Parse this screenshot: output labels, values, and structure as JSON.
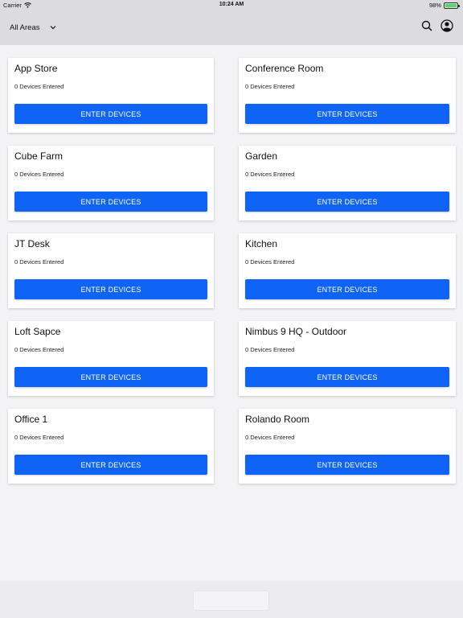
{
  "status_bar": {
    "carrier": "Carrier",
    "time": "10:24 AM",
    "battery": "98%",
    "battery_level": 0.98,
    "battery_color": "#4cd964"
  },
  "nav": {
    "area_filter": "All Areas",
    "icons": [
      "chevron-down-icon",
      "search-icon",
      "profile-icon"
    ]
  },
  "theme": {
    "accent": "#0f63f5",
    "background": "#f3f3f6"
  },
  "areas": [
    {
      "name": "App Store",
      "devices": "0 Devices Entered",
      "button": "ENTER DEVICES"
    },
    {
      "name": "Conference Room",
      "devices": "0 Devices Entered",
      "button": "ENTER DEVICES"
    },
    {
      "name": "Cube Farm",
      "devices": "0 Devices Entered",
      "button": "ENTER DEVICES"
    },
    {
      "name": "Garden",
      "devices": "0 Devices Entered",
      "button": "ENTER DEVICES"
    },
    {
      "name": "JT Desk",
      "devices": "0 Devices Entered",
      "button": "ENTER DEVICES"
    },
    {
      "name": "Kitchen",
      "devices": "0 Devices Entered",
      "button": "ENTER DEVICES"
    },
    {
      "name": "Loft Sapce",
      "devices": "0 Devices Entered",
      "button": "ENTER DEVICES"
    },
    {
      "name": "Nimbus 9 HQ - Outdoor",
      "devices": "0 Devices Entered",
      "button": "ENTER DEVICES"
    },
    {
      "name": "Office 1",
      "devices": "0 Devices Entered",
      "button": "ENTER DEVICES"
    },
    {
      "name": "Rolando Room",
      "devices": "0 Devices Entered",
      "button": "ENTER DEVICES"
    }
  ]
}
